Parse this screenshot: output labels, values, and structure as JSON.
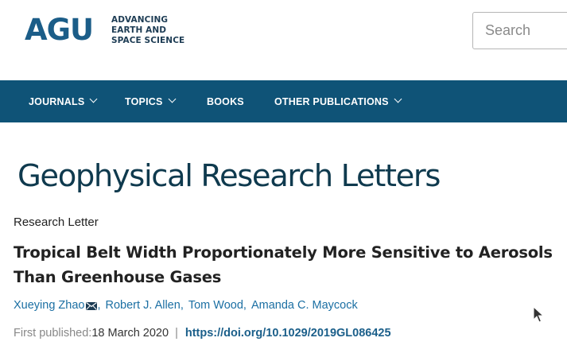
{
  "header": {
    "logo_mark": "AGU",
    "logo_tagline": [
      "ADVANCING",
      "EARTH AND",
      "SPACE SCIENCE"
    ],
    "search_placeholder": "Search"
  },
  "nav": {
    "items": [
      {
        "label": "JOURNALS",
        "has_dropdown": true
      },
      {
        "label": "TOPICS",
        "has_dropdown": true
      },
      {
        "label": "BOOKS",
        "has_dropdown": false
      },
      {
        "label": "OTHER PUBLICATIONS",
        "has_dropdown": true
      }
    ]
  },
  "journal": {
    "title": "Geophysical Research Letters"
  },
  "article": {
    "type": "Research Letter",
    "title": "Tropical Belt Width Proportionately More Sensitive to Aerosols Than Greenhouse Gases",
    "authors": [
      "Xueying Zhao",
      "Robert J. Allen",
      "Tom Wood",
      "Amanda C. Maycock"
    ],
    "first_published_label": "First published:",
    "first_published_date": "18 March 2020",
    "separator": "|",
    "doi": "https://doi.org/10.1029/2019GL086425"
  },
  "colors": {
    "nav_bg": "#0f5377",
    "brand_blue": "#1b5d88",
    "link_blue": "#1b6fa3",
    "journal_title": "#0f3a4e"
  }
}
